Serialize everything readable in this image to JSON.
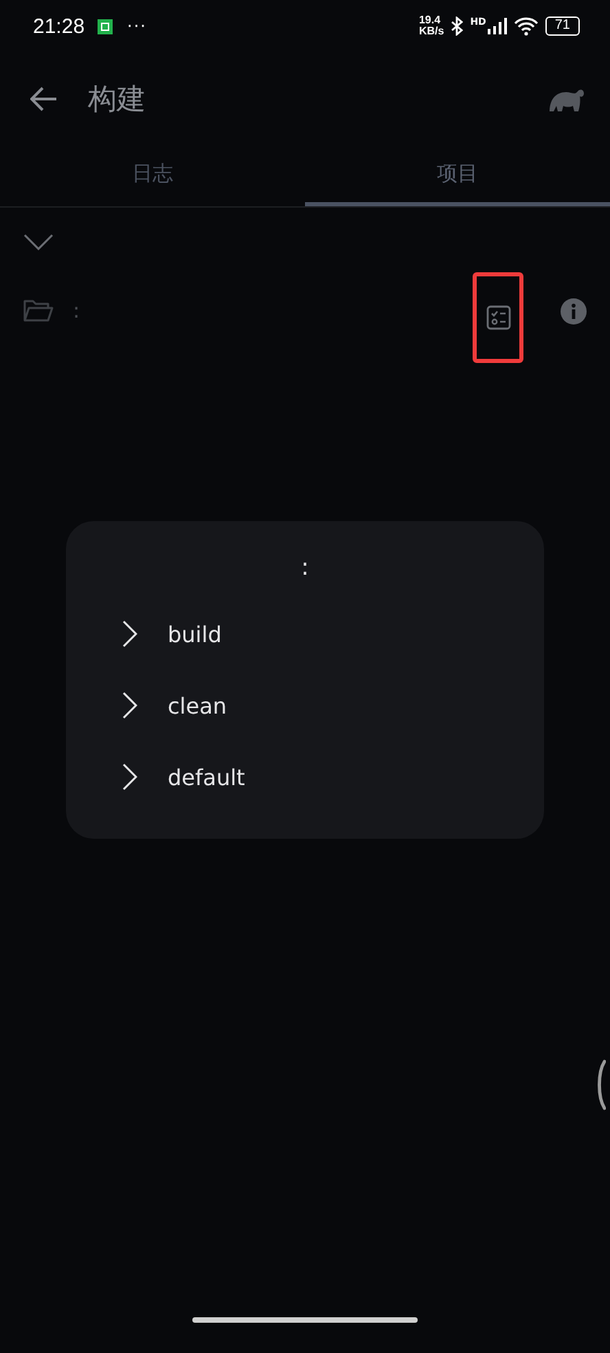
{
  "status_bar": {
    "time": "21:28",
    "more": "···",
    "net_speed": [
      "19.4",
      "KB/s"
    ],
    "network_label": "HD",
    "battery": "71"
  },
  "header": {
    "title": "构建"
  },
  "tabs": [
    {
      "label": "日志",
      "selected": false
    },
    {
      "label": "项目",
      "selected": true
    }
  ],
  "project": {
    "expanded": true,
    "name": ":",
    "task_list_highlighted": true
  },
  "dialog": {
    "title": ":",
    "items": [
      {
        "label": "build"
      },
      {
        "label": "clean"
      },
      {
        "label": "default"
      }
    ]
  }
}
